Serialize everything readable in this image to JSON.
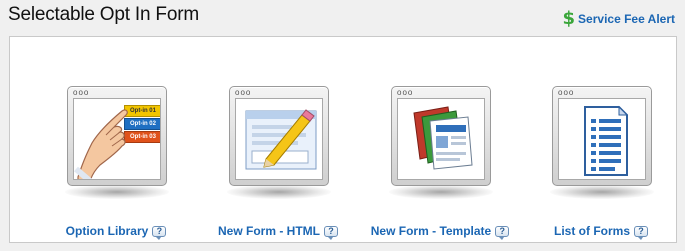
{
  "header": {
    "title": "Selectable Opt In Form",
    "fee_alert": {
      "icon": "dollar-icon",
      "symbol": "$",
      "label": "Service Fee Alert"
    }
  },
  "tiles": [
    {
      "label": "Option Library",
      "icon": "option-library-icon",
      "options": [
        "Opt-in 01",
        "Opt-in 02",
        "Opt-in 03"
      ],
      "option_colors": [
        "#f2c500",
        "#1f6fc2",
        "#e0521b"
      ]
    },
    {
      "label": "New Form - HTML",
      "icon": "form-pencil-icon"
    },
    {
      "label": "New Form - Template",
      "icon": "stacked-templates-icon"
    },
    {
      "label": "List of Forms",
      "icon": "document-list-icon"
    }
  ],
  "help": {
    "glyph": "?"
  },
  "window_dots": "ooo",
  "colors": {
    "link": "#1b66b3",
    "dollar": "#3aa63a",
    "panel_border": "#c9c9c9"
  }
}
